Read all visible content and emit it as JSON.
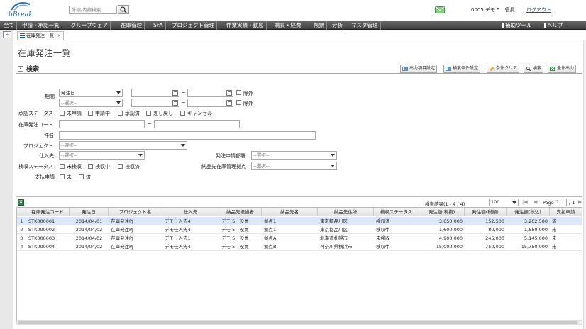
{
  "header": {
    "logo_text": "bBreak",
    "search_placeholder": "外線/内線検索",
    "user": "0005 デモ 5　役員",
    "logout": "ログアウト"
  },
  "menu": {
    "items": [
      "全て",
      "申請・承認一覧",
      "グループウェア",
      "在庫管理",
      "SFA",
      "プロジェクト管理",
      "作業実績・勤怠",
      "購買・経費",
      "帳票",
      "分析",
      "マスタ管理"
    ],
    "right": [
      "補助ツール",
      "ヘルプ"
    ]
  },
  "tab": {
    "label": "在庫発注一覧",
    "close": "×"
  },
  "page_title": "在庫発注一覧",
  "search": {
    "title": "検索",
    "buttons": [
      "出力項目設定",
      "検索条件設定",
      "条件クリア",
      "検索",
      "全件出力"
    ],
    "period_label": "期間",
    "period_select1": "発注日",
    "period_select2": "--選択--",
    "tilde": "~",
    "exclude": "除外",
    "approval_label": "承認ステータス",
    "approval_options": [
      "未申請",
      "申請中",
      "承認済",
      "差し戻し",
      "キャンセル"
    ],
    "code_label": "在庫発注コード",
    "subject_label": "件名",
    "project_label": "プロジェクト",
    "project_value": "--選択--",
    "supplier_label": "仕入先",
    "supplier_value": "--選択--",
    "dept_label": "発注申請部署",
    "dept_value": "--選択--",
    "inspect_label": "検収ステータス",
    "inspect_options": [
      "未検収",
      "検収中",
      "検収済"
    ],
    "base_label": "納品先在庫管理拠点",
    "base_value": "--選択--",
    "pay_label": "支払申請",
    "pay_options": [
      "未",
      "済"
    ]
  },
  "results": {
    "count_text": "検索結果(1 - 4 / 4)",
    "page_size": "100",
    "page_label": "Page",
    "page_value": "1",
    "page_of": "/ 1",
    "nav": [
      "|◀",
      "◀",
      "▶",
      "▶|"
    ],
    "columns": [
      "在庫発注コード",
      "発注日",
      "プロジェクト名",
      "仕入先",
      "納品先担当者",
      "納品先名",
      "納品先住所",
      "検収ステータス",
      "発注額(税抜)",
      "発注額(税額)",
      "発注額(税込)",
      "支払申請"
    ],
    "rows": [
      {
        "num": "1",
        "code": "STK000001",
        "date": "2014/04/01",
        "project": "在庫発注PJ",
        "supplier": "デモ仕入先4",
        "contact": "デモ 5　役員",
        "dest": "拠点1",
        "address": "東京都品川区",
        "status": "検収済",
        "excl": "3,050,000",
        "tax": "152,500",
        "incl": "3,202,500",
        "pay": "済"
      },
      {
        "num": "2",
        "code": "STK000002",
        "date": "2014/04/02",
        "project": "在庫発注PJ",
        "supplier": "デモ仕入先4",
        "contact": "デモ 5　役員",
        "dest": "拠点1",
        "address": "東京都品川区",
        "status": "検収中",
        "excl": "1,600,000",
        "tax": "80,000",
        "incl": "1,680,000",
        "pay": "未"
      },
      {
        "num": "3",
        "code": "STK000003",
        "date": "2014/04/02",
        "project": "在庫発注PJ",
        "supplier": "デモ仕入先1",
        "contact": "デモ 5　役員",
        "dest": "拠点A",
        "address": "北海道札幌市",
        "status": "未検収",
        "excl": "4,900,000",
        "tax": "245,000",
        "incl": "5,145,000",
        "pay": "未"
      },
      {
        "num": "4",
        "code": "STK000004",
        "date": "2014/04/02",
        "project": "在庫発注PJ",
        "supplier": "デモ仕入先4",
        "contact": "デモ 5　役員",
        "dest": "拠点B",
        "address": "神奈川県横浜市",
        "status": "検収中",
        "excl": "15,000,000",
        "tax": "750,000",
        "incl": "15,750,000",
        "pay": "未"
      }
    ]
  },
  "colors": {
    "menu_bg": "#4a4a4a",
    "selected_row": "#dbe8fb",
    "link": "#1a4fa6",
    "logo": "#2a6bb5",
    "excel": "#2a8a3e"
  }
}
